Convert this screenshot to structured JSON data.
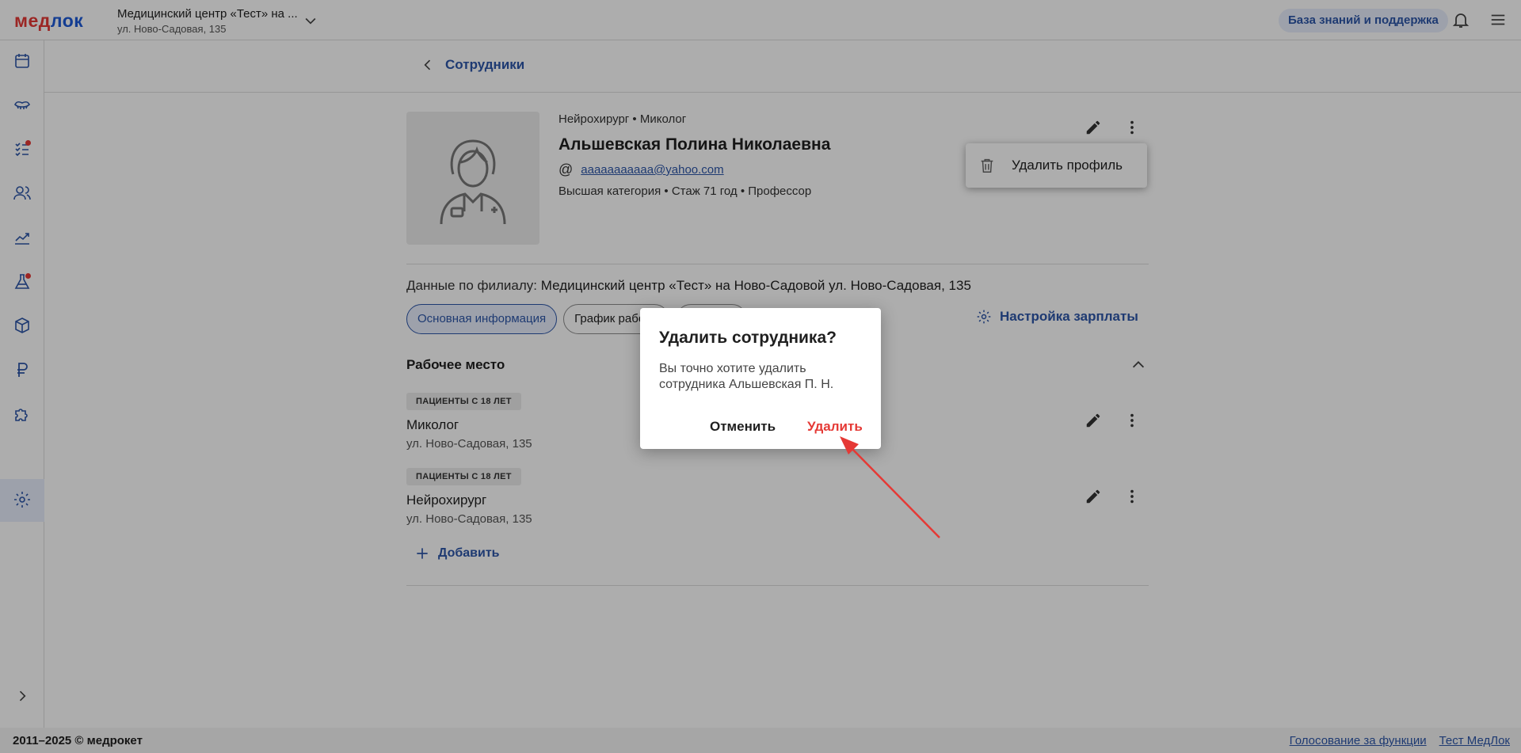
{
  "header": {
    "logo_part1": "мед",
    "logo_part2": "лок",
    "clinic_name": "Медицинский центр «Тест» на ...",
    "clinic_address": "ул. Ново-Садовая, 135",
    "help_label": "База знаний и поддержка"
  },
  "back_label": "Сотрудники",
  "employee": {
    "specialties": "Нейрохирург • Миколог",
    "name": "Альшевская Полина Николаевна",
    "email": "aaaaaaaaaaa@yahoo.com",
    "meta": "Высшая категория • Стаж 71 год • Профессор"
  },
  "menu": {
    "delete_profile": "Удалить профиль"
  },
  "branch": {
    "label": "Данные по филиалу:",
    "value": "Медицинский центр «Тест» на Ново-Садовой ул. Ново-Садовая, 135"
  },
  "tabs": [
    "Основная информация",
    "График работы",
    ""
  ],
  "salary_label": "Настройка зарплаты",
  "workplace": {
    "title": "Рабочее место",
    "items": [
      {
        "badge": "ПАЦИЕНТЫ С 18 ЛЕТ",
        "title": "Миколог",
        "address": "ул. Ново-Садовая, 135"
      },
      {
        "badge": "ПАЦИЕНТЫ С 18 ЛЕТ",
        "title": "Нейрохирург",
        "address": "ул. Ново-Садовая, 135"
      }
    ],
    "add_label": "Добавить"
  },
  "footer": {
    "copyright": "2011–2025 © медрокет",
    "link_vote": "Голосование за функции",
    "link_test": "Тест МедЛок"
  },
  "dialog": {
    "title": "Удалить сотрудника?",
    "text": "Вы точно хотите удалить сотрудника Альшевская П. Н.",
    "cancel": "Отменить",
    "confirm": "Удалить"
  },
  "colors": {
    "accent": "#2d56a8",
    "danger": "#e53935",
    "overlay": "rgba(0,0,0,0.32)"
  },
  "icons": [
    "calendar-icon",
    "tooth-icon",
    "checklist-icon",
    "users-icon",
    "chart-icon",
    "flask-icon",
    "box-icon",
    "ruble-icon",
    "puzzle-icon",
    "gear-icon"
  ]
}
